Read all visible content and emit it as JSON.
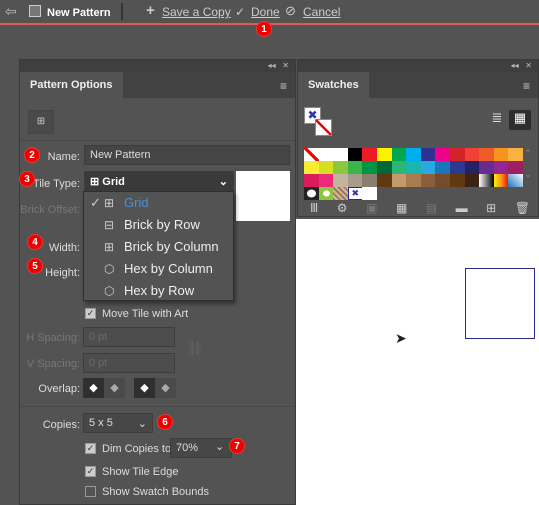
{
  "topbar": {
    "title": "New Pattern",
    "save_copy": "Save a Copy",
    "done": "Done",
    "cancel": "Cancel",
    "accent": "#e05a5a"
  },
  "badges": [
    "1",
    "2",
    "3",
    "4",
    "5",
    "6",
    "7"
  ],
  "pattern_options": {
    "tab": "Pattern Options",
    "name_label": "Name:",
    "name_value": "New Pattern",
    "tile_type_label": "Tile Type:",
    "tile_type_value": "Grid",
    "brick_offset_label": "Brick Offset:",
    "width_label": "Width:",
    "height_label": "Height:",
    "tile_types": [
      {
        "label": "Grid",
        "selected": true
      },
      {
        "label": "Brick by Row"
      },
      {
        "label": "Brick by Column"
      },
      {
        "label": "Hex by Column"
      },
      {
        "label": "Hex by Row"
      }
    ],
    "move_tile": "Move Tile with Art",
    "h_spacing_label": "H Spacing:",
    "h_spacing_value": "0 pt",
    "v_spacing_label": "V Spacing:",
    "v_spacing_value": "0 pt",
    "overlap_label": "Overlap:",
    "copies_label": "Copies:",
    "copies_value": "5 x 5",
    "dim_copies": "Dim Copies to:",
    "dim_value": "70%",
    "show_tile_edge": "Show Tile Edge",
    "show_swatch_bounds": "Show Swatch Bounds"
  },
  "swatches": {
    "tab": "Swatches",
    "rows": [
      [
        "none",
        "reg",
        "#ffffff",
        "#000000",
        "#ed1c24",
        "#fff200",
        "#00a651",
        "#00aeef",
        "#2e3192",
        "#ec008c",
        "#d2232a",
        "#ef4136",
        "#f15a29",
        "#f7941d",
        "#fbb040"
      ],
      [
        "#f9ed32",
        "#d7df23",
        "#8dc63f",
        "#39b54a",
        "#009444",
        "#006838",
        "#2bb673",
        "#1bb5ad",
        "#27aae1",
        "#1c75bc",
        "#2b3990",
        "#262262",
        "#662d91",
        "#92278f",
        "#9e1f63"
      ],
      [
        "#da1c5c",
        "#ee2a7b",
        "#c2b59b",
        "#a79b8e",
        "#8b7e6e",
        "#603913",
        "#c49a6c",
        "#a97c50",
        "#8b5e3c",
        "#754c29",
        "#603913",
        "#3c2415",
        "grad1",
        "grad2",
        "grad3"
      ],
      [
        "pat1",
        "pat2",
        "pat3",
        "pat4",
        "#ffffff"
      ]
    ]
  }
}
